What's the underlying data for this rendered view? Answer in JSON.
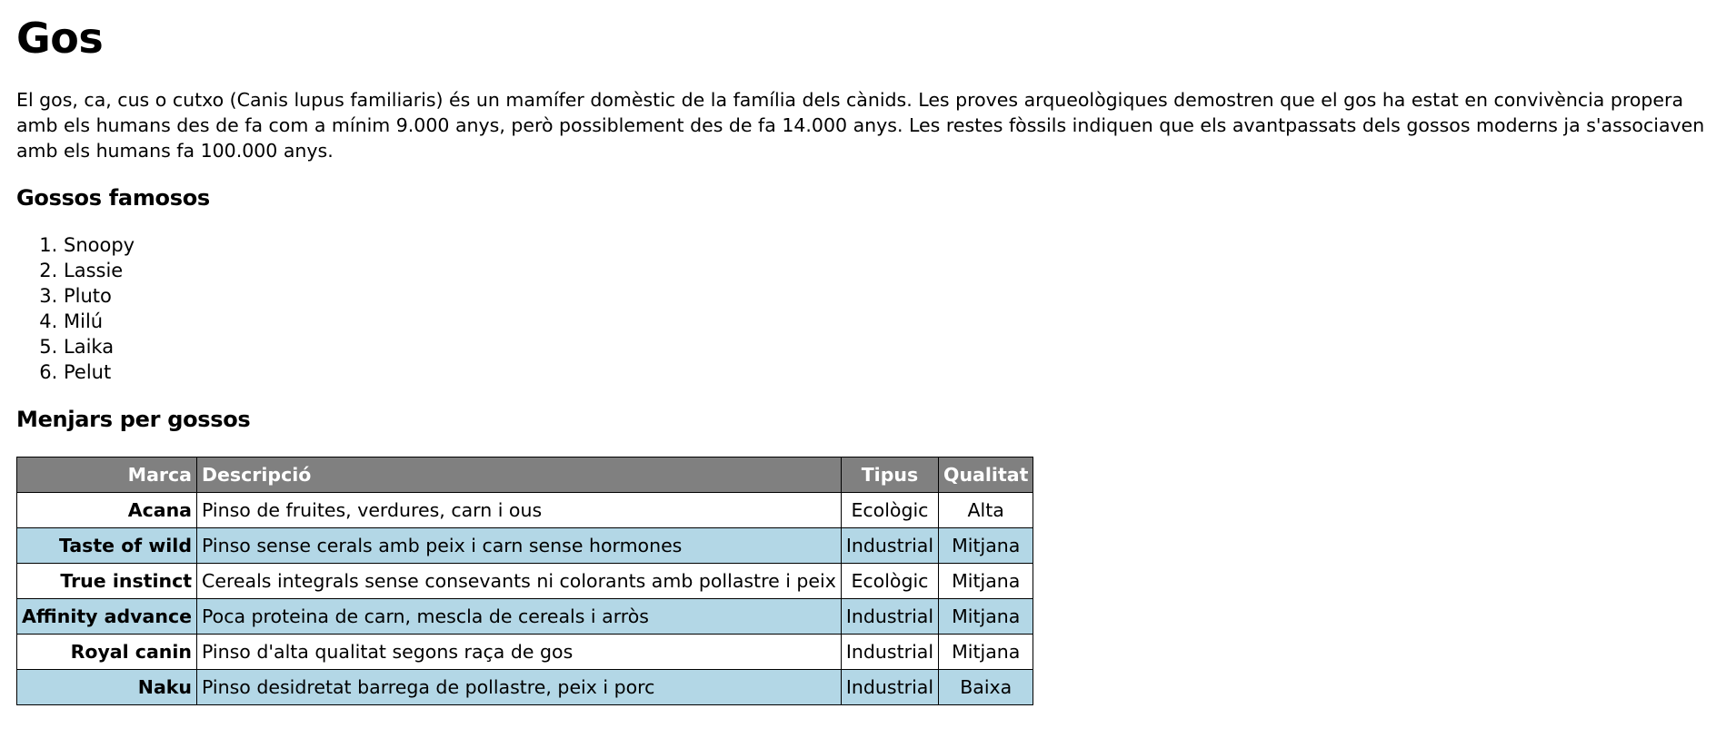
{
  "title": "Gos",
  "intro": "El gos, ca, cus o cutxo (Canis lupus familiaris) és un mamífer domèstic de la família dels cànids. Les proves arqueològiques demostren que el gos ha estat en convivència propera amb els humans des de fa com a mínim 9.000 anys, però possiblement des de fa 14.000 anys. Les restes fòssils indiquen que els avantpassats dels gossos moderns ja s'associaven amb els humans fa 100.000 anys.",
  "famous": {
    "heading": "Gossos famosos",
    "items": [
      "Snoopy",
      "Lassie",
      "Pluto",
      "Milú",
      "Laika",
      "Pelut"
    ]
  },
  "food": {
    "heading": "Menjars per gossos",
    "headers": {
      "brand": "Marca",
      "description": "Descripció",
      "type": "Tipus",
      "quality": "Qualitat"
    },
    "rows": [
      {
        "brand": "Acana",
        "description": "Pinso de fruites, verdures, carn i ous",
        "type": "Ecològic",
        "quality": "Alta"
      },
      {
        "brand": "Taste of wild",
        "description": "Pinso sense cerals amb peix i carn sense hormones",
        "type": "Industrial",
        "quality": "Mitjana"
      },
      {
        "brand": "True instinct",
        "description": "Cereals integrals sense consevants ni colorants amb pollastre i peix",
        "type": "Ecològic",
        "quality": "Mitjana"
      },
      {
        "brand": "Affinity advance",
        "description": "Poca proteina de carn, mescla de cereals i arròs",
        "type": "Industrial",
        "quality": "Mitjana"
      },
      {
        "brand": "Royal canin",
        "description": "Pinso d'alta qualitat segons raça de gos",
        "type": "Industrial",
        "quality": "Mitjana"
      },
      {
        "brand": "Naku",
        "description": "Pinso desidretat barrega de pollastre, peix i porc",
        "type": "Industrial",
        "quality": "Baixa"
      }
    ]
  },
  "colors": {
    "header_bg": "#808080",
    "stripe_bg": "#b3d7e6"
  }
}
